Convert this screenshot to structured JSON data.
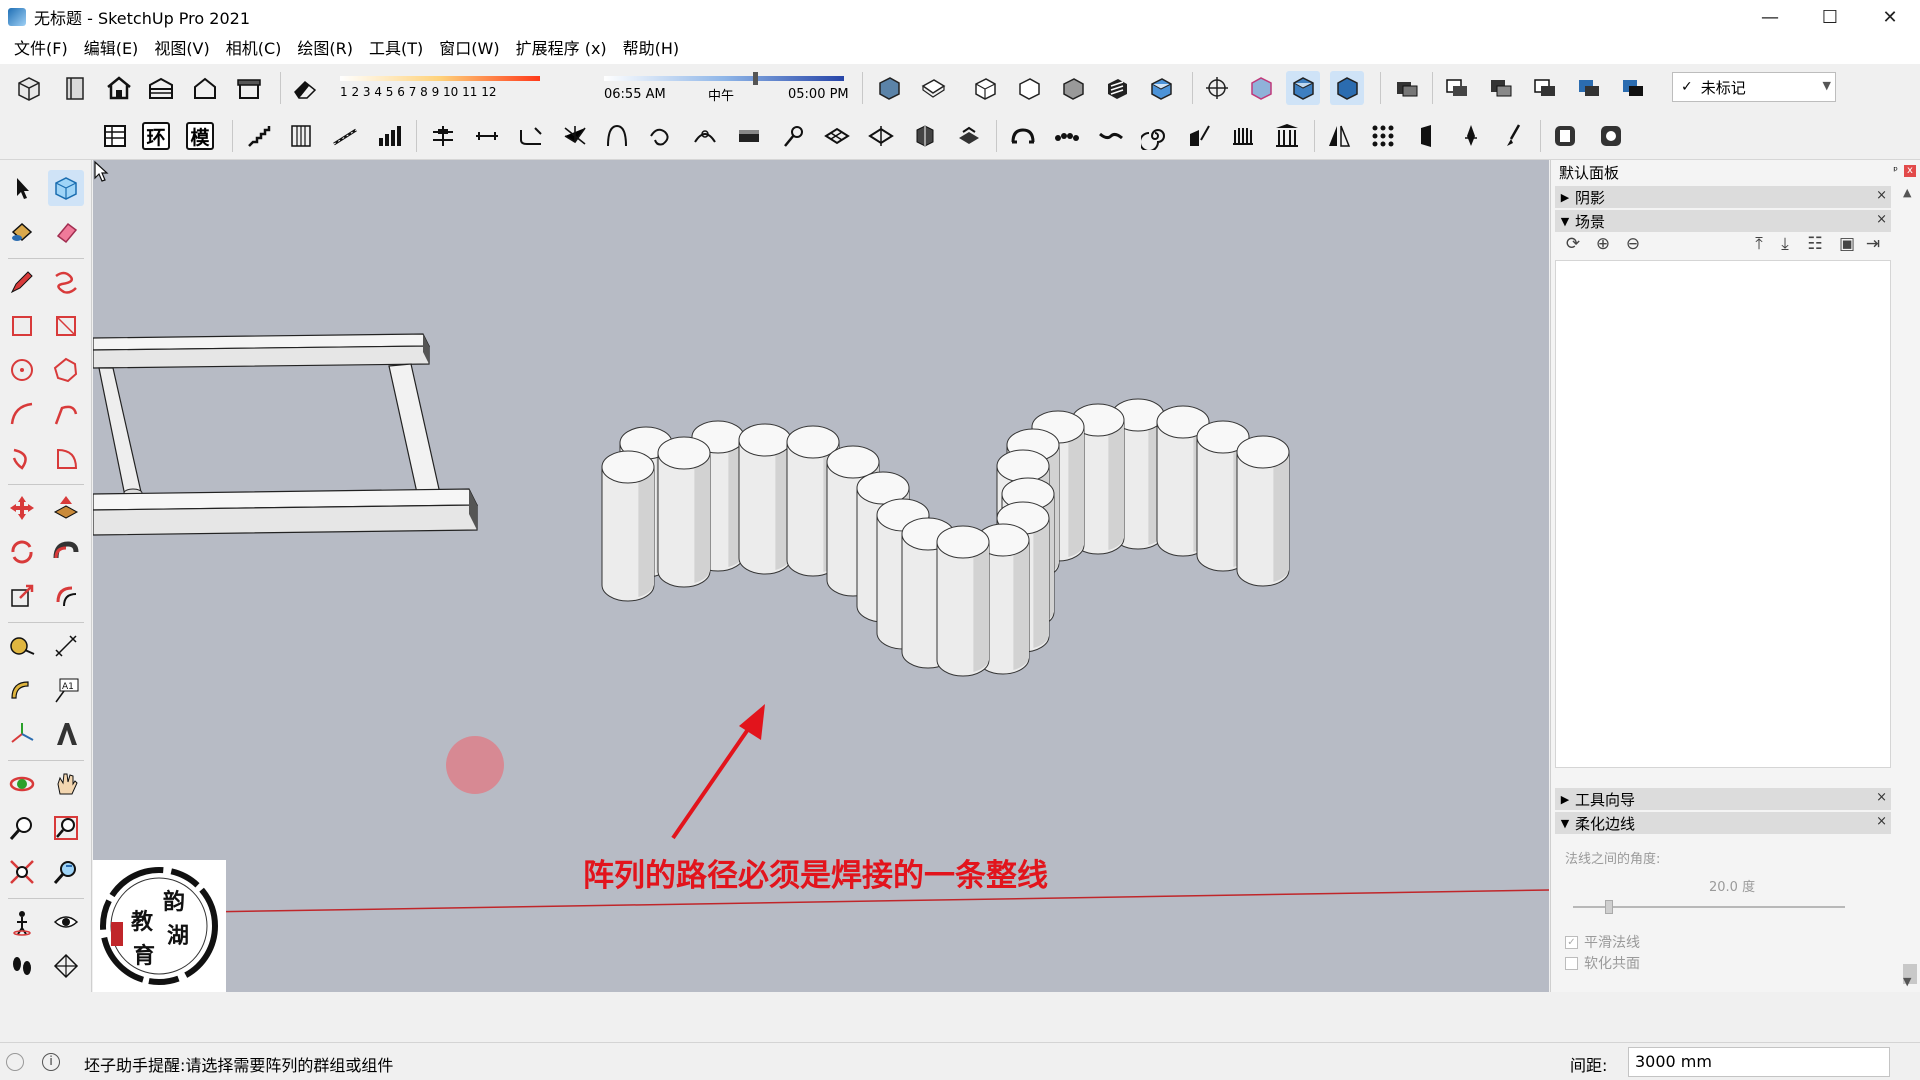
{
  "window": {
    "title": "无标题 - SketchUp Pro 2021",
    "minimize": "—",
    "maximize": "☐",
    "close": "✕"
  },
  "menu": [
    "文件(F)",
    "编辑(E)",
    "视图(V)",
    "相机(C)",
    "绘图(R)",
    "工具(T)",
    "窗口(W)",
    "扩展程序 (x)",
    "帮助(H)"
  ],
  "shadow_settings": {
    "months": "1 2 3 4 5 6 7 8 9 10 11 12",
    "time_start": "06:55 AM",
    "time_mid": "中午",
    "time_end": "05:00 PM",
    "time_position": 0.62
  },
  "tag_select": {
    "check": "✓",
    "value": "未标记"
  },
  "toolbar2_text_buttons": [
    "环",
    "模"
  ],
  "viewport": {
    "annotation": "阵列的路径必须是焊接的一条整线",
    "annotation_color": "#e2141c",
    "logo_chars": [
      "韵",
      "湖",
      "教",
      "育"
    ]
  },
  "tray": {
    "title": "默认面板",
    "pin": "ᵖ",
    "close": "x",
    "panels": [
      {
        "label": "阴影",
        "expanded": false,
        "arrow": "▶"
      },
      {
        "label": "场景",
        "expanded": true,
        "arrow": "▼"
      },
      {
        "label": "工具向导",
        "expanded": false,
        "arrow": "▶"
      },
      {
        "label": "柔化边线",
        "expanded": true,
        "arrow": "▼"
      }
    ],
    "panel_close": "×",
    "soften": {
      "angle_label": "法线之间的角度:",
      "angle_value": "20.0  度",
      "angle_fraction": 0.12,
      "smooth_normals": "平滑法线",
      "soften_coplanar": "软化共面",
      "smooth_normals_checked": true,
      "soften_coplanar_checked": false
    }
  },
  "status": {
    "hint": "坯子助手提醒:请选择需要阵列的群组或组件",
    "measure_label": "间距:",
    "measure_value": "3000 mm",
    "info_icon": "i"
  },
  "icons": {
    "toolbar1": [
      "cube-icon",
      "book-icon",
      "house-icon",
      "warehouse-icon",
      "house-outline-icon",
      "store-icon",
      "eraser-icon",
      "iso-view-icon",
      "top-view-icon",
      "front-view-icon",
      "right-view-icon",
      "back-view-icon",
      "left-view-icon",
      "bottom-view-icon",
      "xray-icon",
      "back-edges-icon",
      "wireframe-icon",
      "hidden-line-icon",
      "shaded-icon",
      "textured-icon",
      "monochrome-icon",
      "section-plane-icon",
      "section-cut-icon",
      "section-fill-icon",
      "show-sections-icon",
      "solid-union-icon",
      "solid-subtract-icon",
      "solid-trim-icon",
      "solid-intersect-icon",
      "solid-split-icon",
      "solid-outer-shell-icon"
    ],
    "toolbar2": [
      "table-icon",
      "ring-text-icon",
      "model-text-icon",
      "stairs-icon",
      "column-icon",
      "ramp-icon",
      "bar-chart-icon",
      "align-icon",
      "distribute-icon",
      "fillet-icon",
      "chamfer-icon",
      "bezier-icon",
      "bend-icon",
      "spline-icon",
      "extrude-icon",
      "follow-icon",
      "lattice-icon",
      "grid-icon",
      "component-icon",
      "array-icon",
      "arch-icon",
      "beads-icon",
      "wave-icon",
      "spiral-icon",
      "flip-icon",
      "comb-icon",
      "pillars-icon",
      "mirror-icon",
      "dots-grid-icon",
      "door-icon",
      "pen-icon",
      "brush-icon",
      "box-icon",
      "camera-icon"
    ],
    "left": [
      "select-icon",
      "make-component-icon",
      "paint-bucket-icon",
      "eraser-icon",
      "pencil-icon",
      "freehand-icon",
      "rectangle-icon",
      "rotated-rectangle-icon",
      "circle-icon",
      "polygon-icon",
      "arc-icon",
      "two-point-arc-icon",
      "three-point-arc-icon",
      "pie-icon",
      "move-icon",
      "push-pull-icon",
      "rotate-icon",
      "follow-me-icon",
      "scale-icon",
      "offset-icon",
      "tape-measure-icon",
      "dimension-icon",
      "protractor-icon",
      "text-icon",
      "axes-icon",
      "3d-text-icon",
      "orbit-icon",
      "pan-icon",
      "zoom-icon",
      "zoom-window-icon",
      "zoom-extents-icon",
      "previous-view-icon",
      "position-camera-icon",
      "look-around-icon",
      "walk-icon",
      "section-plane-icon"
    ]
  }
}
